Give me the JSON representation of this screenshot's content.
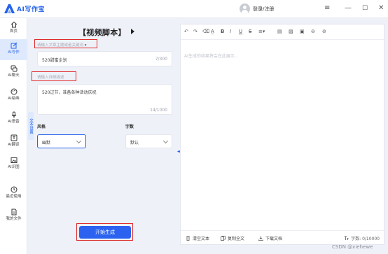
{
  "app": {
    "name": "AI写作宝",
    "login_label": "登录/注册",
    "accent": "#2463eb"
  },
  "window_controls": [
    "≡",
    "—",
    "☐",
    "✕"
  ],
  "sidebar": {
    "items": [
      {
        "label": "首页",
        "icon": "home-icon",
        "active": false
      },
      {
        "label": "AI写作",
        "icon": "edit-icon",
        "active": true
      },
      {
        "label": "AI聊天",
        "icon": "chat-icon",
        "active": false
      },
      {
        "label": "AI绘画",
        "icon": "palette-icon",
        "active": false
      },
      {
        "label": "AI语音",
        "icon": "voice-icon",
        "active": false
      },
      {
        "label": "AI翻译",
        "icon": "translate-icon",
        "active": false
      },
      {
        "label": "AI识图",
        "icon": "image-icon",
        "active": false
      },
      {
        "label": "最近使用",
        "icon": "clock-icon",
        "active": false
      },
      {
        "label": "我的文件",
        "icon": "file-icon",
        "active": false
      }
    ]
  },
  "form": {
    "title": "【视频脚本】",
    "topic_hint": "请输入文章主题或者关键词",
    "topic_hint_suffix": "▾",
    "topic_value": "520甜蜜企划",
    "topic_counter": "7/300",
    "desc_hint": "请输入详细描述",
    "desc_value": "520过节，准备各种活动庆祝",
    "desc_counter": "14/1000",
    "side_tab": "文本设置",
    "style_label": "风格",
    "style_value": "幽默",
    "wordcount_label": "字数",
    "wordcount_value": "默认",
    "generate_label": "开始生成"
  },
  "editor": {
    "placeholder": "AI生成的结果将会在此展示...",
    "toolbar_icons": [
      "undo-icon",
      "redo-icon",
      "eraser-icon",
      "text-format-icon",
      "bold-icon",
      "italic-icon",
      "underline-icon",
      "strikethrough-icon",
      "align-icon",
      "table-icon",
      "image-icon",
      "video-icon",
      "code-icon",
      "link-icon"
    ],
    "footer": {
      "clear_label": "清空文本",
      "copy_label": "复制全文",
      "download_label": "下载文档",
      "count_label": "字数: 0/10000"
    }
  },
  "watermark": "CSDN @xiehewe"
}
